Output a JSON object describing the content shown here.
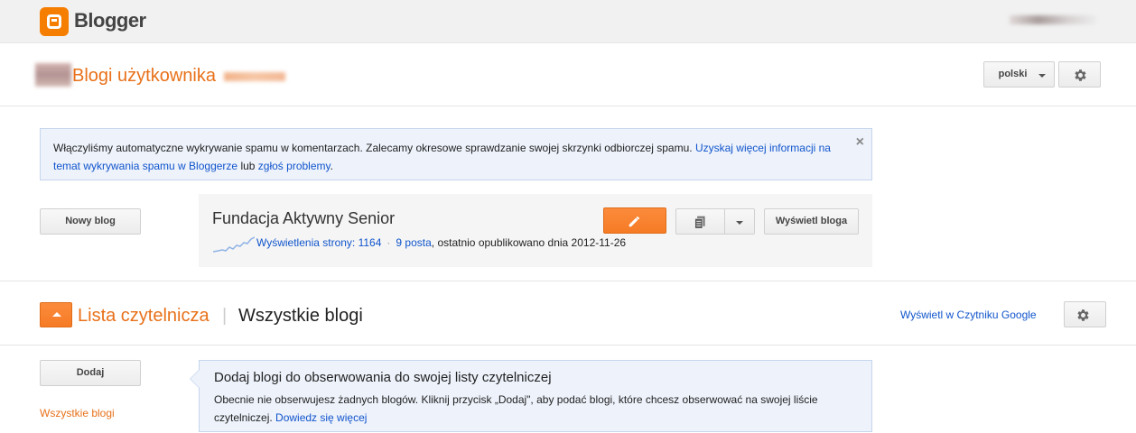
{
  "app": {
    "name": "Blogger",
    "accent": "#f57d00"
  },
  "header": {
    "title": "Blogi użytkownika",
    "language_button": "polski",
    "settings_icon": "gear-icon"
  },
  "notice": {
    "text": "Włączyliśmy automatyczne wykrywanie spamu w komentarzach. Zalecamy okresowe sprawdzanie swojej skrzynki odbiorczej spamu.",
    "link1": "Uzyskaj więcej informacji na temat wykrywania spamu w Bloggerze",
    "middle": "lub",
    "link2": "zgłoś problemy",
    "end": ".",
    "close": "×"
  },
  "blogs": {
    "new_blog_button": "Nowy blog",
    "items": [
      {
        "title": "Fundacja Aktywny Senior",
        "pageviews": "Wyświetlenia strony: 1164",
        "sep": "·",
        "posts": "9 posta",
        "last_published": ", ostatnio opublikowano dnia 2012-11-26",
        "view_button": "Wyświetl bloga"
      }
    ]
  },
  "reading_list": {
    "title": "Lista czytelnicza",
    "separator": "|",
    "subtitle": "Wszystkie blogi",
    "reader_link": "Wyświetl w Czytniku Google",
    "add_button": "Dodaj",
    "all_blogs_link": "Wszystkie blogi",
    "info_title": "Dodaj blogi do obserwowania do swojej listy czytelniczej",
    "info_body": "Obecnie nie obserwujesz żadnych blogów. Kliknij przycisk „Dodaj\", aby podać blogi, które chcesz obserwować na swojej liście czytelniczej.",
    "info_link": "Dowiedz się więcej"
  }
}
